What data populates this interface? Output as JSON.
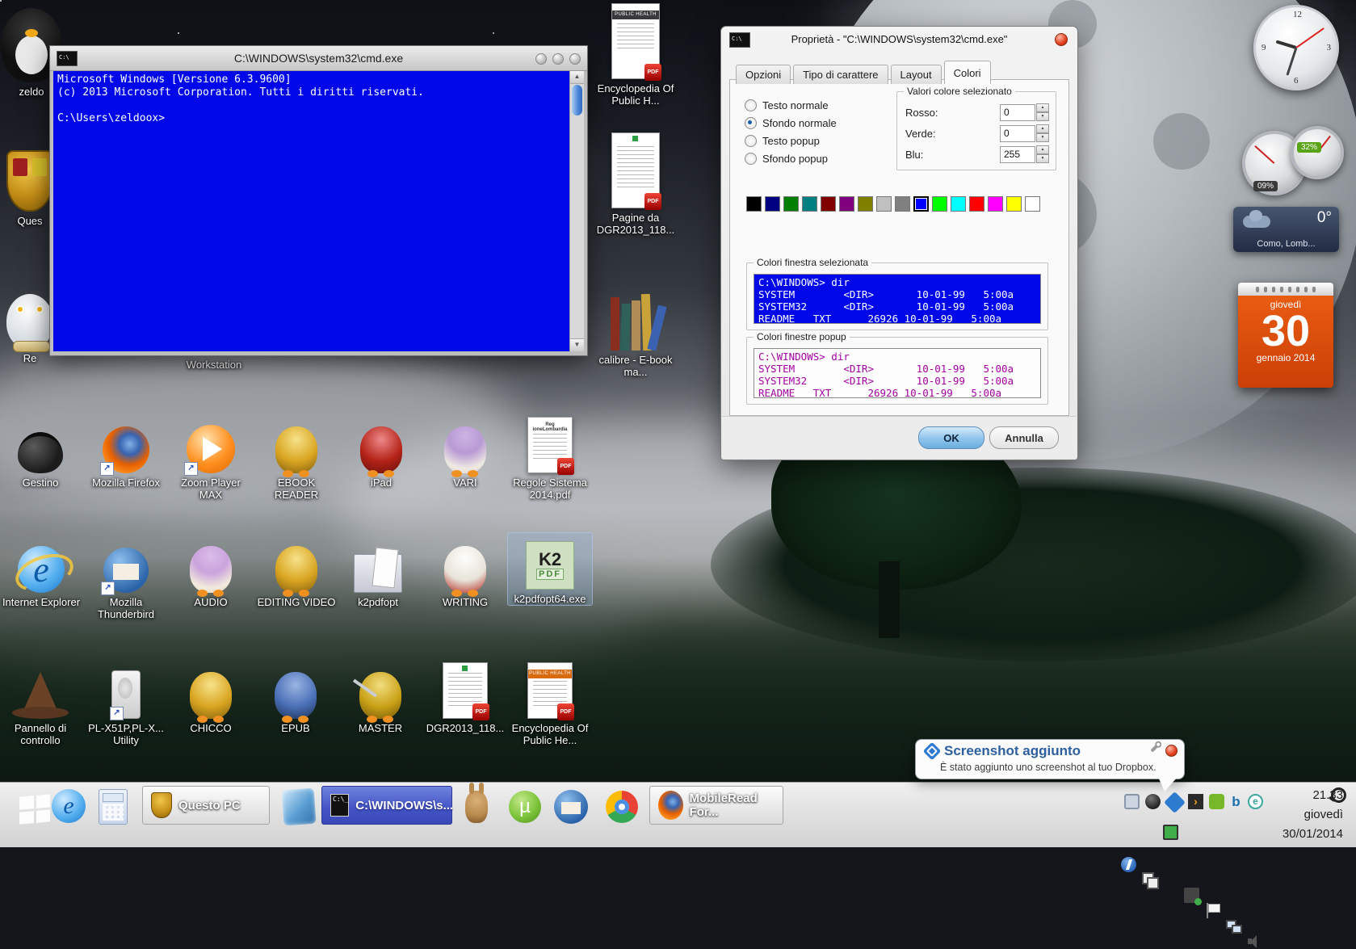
{
  "cmd": {
    "title": "C:\\WINDOWS\\system32\\cmd.exe",
    "line1": "Microsoft Windows [Versione 6.3.9600]",
    "line2": "(c) 2013 Microsoft Corporation. Tutti i diritti riservati.",
    "prompt": "C:\\Users\\zeldoox>"
  },
  "dialog": {
    "title": "Proprietà - \"C:\\WINDOWS\\system32\\cmd.exe\"",
    "tabs": [
      {
        "label": "Opzioni",
        "active": false
      },
      {
        "label": "Tipo di carattere",
        "active": false
      },
      {
        "label": "Layout",
        "active": false
      },
      {
        "label": "Colori",
        "active": true
      }
    ],
    "radios": [
      {
        "label": "Testo normale",
        "selected": false
      },
      {
        "label": "Sfondo normale",
        "selected": true
      },
      {
        "label": "Testo popup",
        "selected": false
      },
      {
        "label": "Sfondo popup",
        "selected": false
      }
    ],
    "values_group_title": "Valori colore selezionato",
    "value_rows": [
      {
        "label": "Rosso:",
        "value": "0"
      },
      {
        "label": "Verde:",
        "value": "0"
      },
      {
        "label": "Blu:",
        "value": "255"
      }
    ],
    "palette": [
      "#000000",
      "#000080",
      "#008000",
      "#008080",
      "#800000",
      "#800080",
      "#808000",
      "#C0C0C0",
      "#808080",
      "#0000FF",
      "#00FF00",
      "#00FFFF",
      "#FF0000",
      "#FF00FF",
      "#FFFF00",
      "#FFFFFF"
    ],
    "selected_palette_index": 9,
    "screen_group_title": "Colori finestra selezionata",
    "popup_group_title": "Colori finestre popup",
    "preview_lines": [
      "C:\\WINDOWS> dir",
      "SYSTEM        <DIR>       10-01-99   5:00a",
      "SYSTEM32      <DIR>       10-01-99   5:00a",
      "README   TXT      26926 10-01-99   5:00a"
    ],
    "ok_label": "OK",
    "cancel_label": "Annulla"
  },
  "desktop": {
    "left_icons": [
      {
        "label": "zeldo"
      },
      {
        "label": "Ques"
      },
      {
        "label": "Re"
      }
    ],
    "workstation_label": "Workstation",
    "right_icons": [
      {
        "label": "Encyclopedia Of Public H..."
      },
      {
        "label": "Pagine da DGR2013_118..."
      },
      {
        "label": "calibre - E-book ma..."
      }
    ],
    "row2": [
      {
        "label": "Gestino"
      },
      {
        "label": "Mozilla Firefox"
      },
      {
        "label": "Zoom Player MAX"
      },
      {
        "label": "EBOOK READER"
      },
      {
        "label": "iPad"
      },
      {
        "label": "VARI"
      },
      {
        "label": "Regole Sistema 2014.pdf"
      }
    ],
    "row3": [
      {
        "label": "Internet Explorer"
      },
      {
        "label": "Mozilla Thunderbird"
      },
      {
        "label": "AUDIO"
      },
      {
        "label": "EDITING VIDEO"
      },
      {
        "label": "k2pdfopt"
      },
      {
        "label": "WRITING"
      },
      {
        "label": "k2pdfopt64.exe"
      }
    ],
    "row4": [
      {
        "label": "Pannello di controllo"
      },
      {
        "label": "PL-X51P,PL-X... Utility"
      },
      {
        "label": "CHICCO"
      },
      {
        "label": "EPUB"
      },
      {
        "label": "MASTER"
      },
      {
        "label": "DGR2013_118..."
      },
      {
        "label": "Encyclopedia Of Public He..."
      }
    ]
  },
  "icon_glyphs": {
    "ie": "e",
    "k2": "K2",
    "k2sub": "PDF",
    "pdf_badge": "PDF",
    "public_health": "PUBLIC HEALTH",
    "regole_header": "Reg ioneLombardia",
    "utorrent": "µ",
    "bing": "b",
    "eset": "e",
    "plex": "›"
  },
  "gadgets": {
    "cpu_badge": "09%",
    "ram_badge": "32%",
    "weather_temp": "0°",
    "weather_location": "Como, Lomb...",
    "calendar_weekday": "giovedì",
    "calendar_day": "30",
    "calendar_month": "gennaio 2014"
  },
  "notification": {
    "title": "Screenshot aggiunto",
    "body": "È stato aggiunto uno screenshot al tuo Dropbox."
  },
  "taskbar": {
    "questo_pc_label": "Questo PC",
    "cmd_button_label": "C:\\WINDOWS\\s...",
    "mobileread_label": "MobileRead For...",
    "clock_time": "21.33",
    "clock_weekday": "giovedì",
    "clock_date": "30/01/2014"
  }
}
